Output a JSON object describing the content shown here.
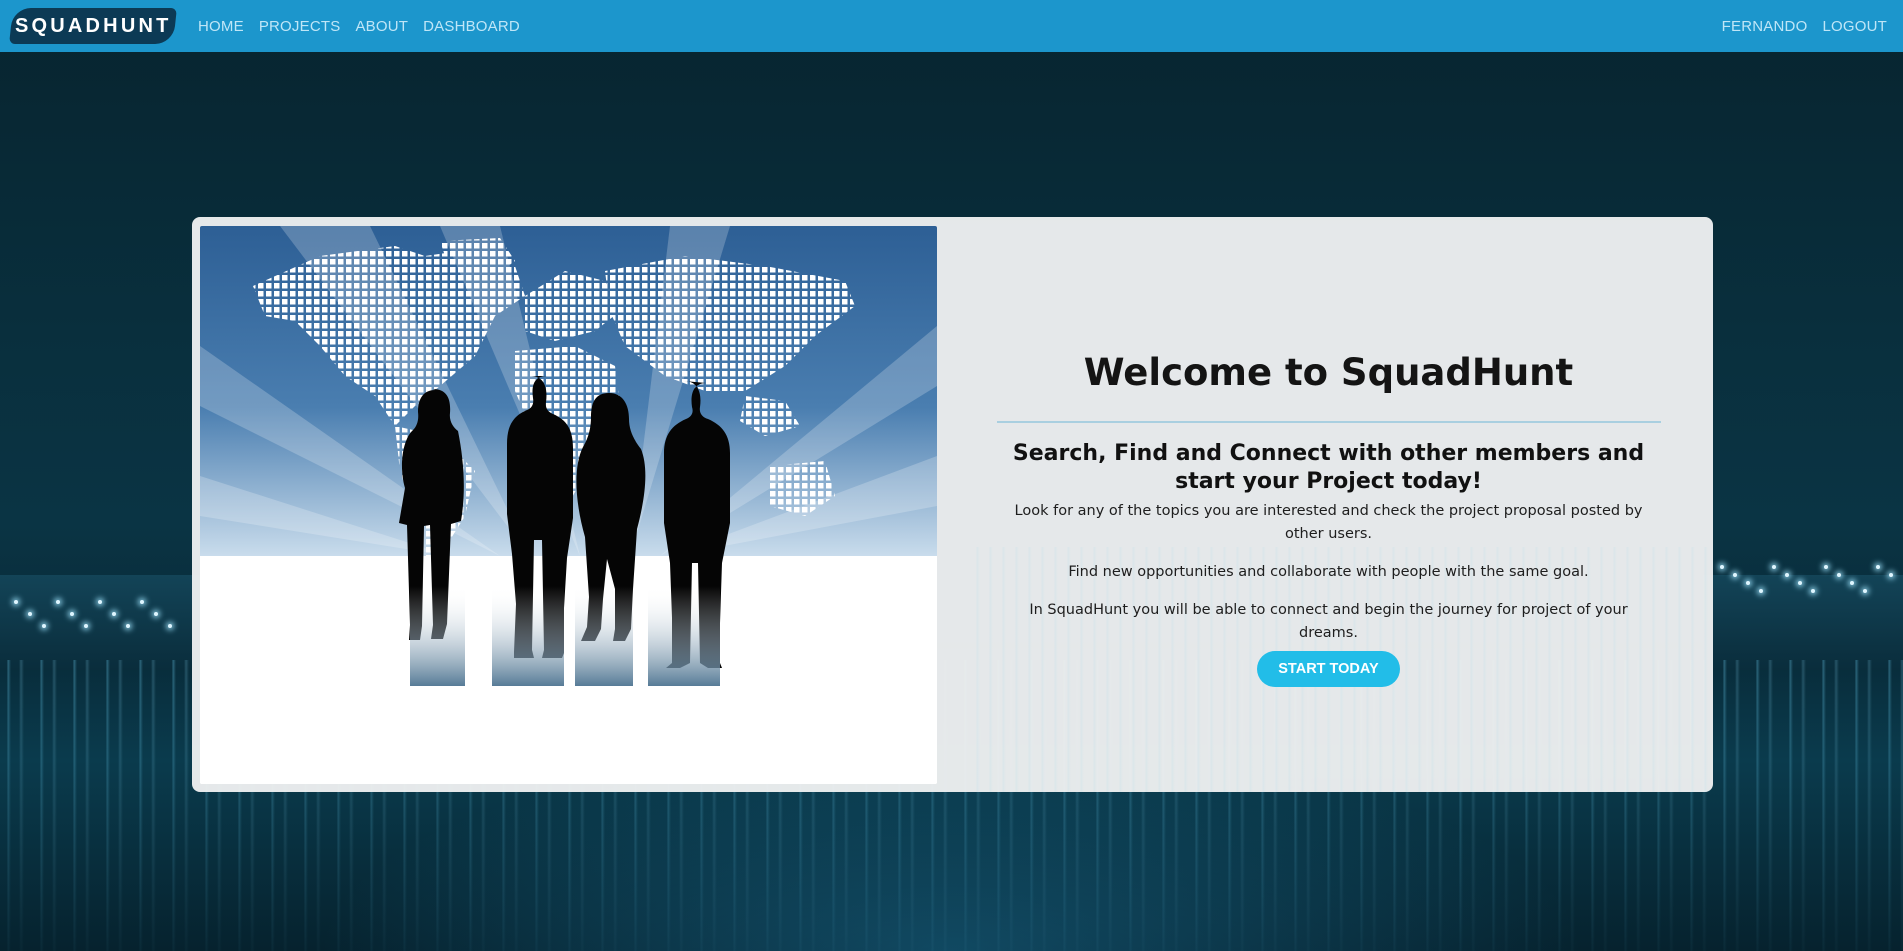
{
  "brand": {
    "name": "SQUADHUNT"
  },
  "nav": {
    "left": [
      {
        "label": "HOME"
      },
      {
        "label": "PROJECTS"
      },
      {
        "label": "ABOUT"
      },
      {
        "label": "DASHBOARD"
      }
    ],
    "right": [
      {
        "label": "FERNANDO"
      },
      {
        "label": "LOGOUT"
      }
    ]
  },
  "hero_card": {
    "title": "Welcome to SquadHunt",
    "subtitle": "Search, Find and Connect with other members and start your Project today!",
    "paragraphs": [
      "Look for any of the topics you are interested and check the project proposal posted by other users.",
      "Find new opportunities and collaborate with people with the same goal.",
      "In SquadHunt you will be able to connect and begin the journey for project of your dreams."
    ],
    "cta_label": "START TODAY"
  },
  "colors": {
    "navbar": "#1c96cc",
    "brand_badge": "#0c3a55",
    "cta": "#22bde8",
    "background": "#062431"
  }
}
